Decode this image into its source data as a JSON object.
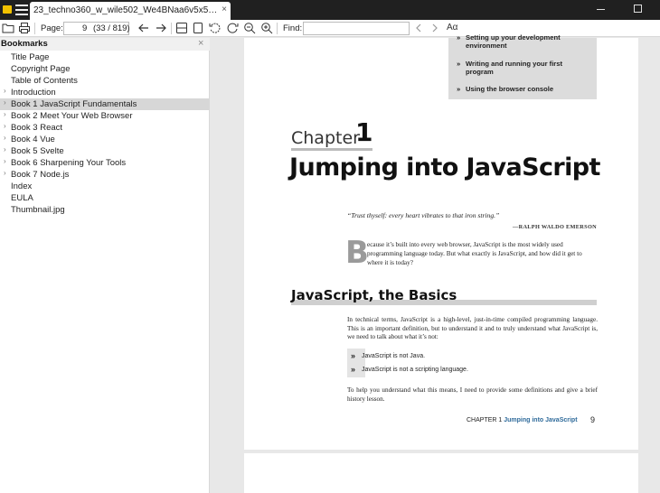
{
  "window": {
    "tab_title": "23_techno360_w_wile502_We4BNaa6v5x5EgPep...",
    "tab_close": "×"
  },
  "toolbar": {
    "page_label": "Page:",
    "page_value": "9",
    "page_info": "(33 / 819)",
    "find_label": "Find:",
    "find_value": "",
    "aa_label": "Aα"
  },
  "sidebar": {
    "title": "Bookmarks",
    "close": "×",
    "items": [
      {
        "label": "Title Page",
        "expandable": false,
        "selected": false
      },
      {
        "label": "Copyright Page",
        "expandable": false,
        "selected": false
      },
      {
        "label": "Table of Contents",
        "expandable": false,
        "selected": false
      },
      {
        "label": "Introduction",
        "expandable": true,
        "selected": false
      },
      {
        "label": "Book 1 JavaScript Fundamentals",
        "expandable": true,
        "selected": true
      },
      {
        "label": "Book 2 Meet Your Web Browser",
        "expandable": true,
        "selected": false
      },
      {
        "label": "Book 3 React",
        "expandable": true,
        "selected": false
      },
      {
        "label": "Book 4 Vue",
        "expandable": true,
        "selected": false
      },
      {
        "label": "Book 5 Svelte",
        "expandable": true,
        "selected": false
      },
      {
        "label": "Book 6 Sharpening Your Tools",
        "expandable": true,
        "selected": false
      },
      {
        "label": "Book 7 Node.js",
        "expandable": true,
        "selected": false
      },
      {
        "label": "Index",
        "expandable": false,
        "selected": false
      },
      {
        "label": "EULA",
        "expandable": false,
        "selected": false
      },
      {
        "label": "Thumbnail.jpg",
        "expandable": false,
        "selected": false
      }
    ]
  },
  "document": {
    "toc_items": [
      "Setting up your development environment",
      "Writing and running your first program",
      "Using the browser console"
    ],
    "chapter_word": "Chapter",
    "chapter_number": "1",
    "chapter_title": "Jumping into JavaScript",
    "quote": "“Trust thyself: every heart vibrates to that iron string.”",
    "attribution": "—RALPH WALDO EMERSON",
    "dropcap": "B",
    "para1": "ecause it’s built into every web browser, JavaScript is the most widely used programming language today. But what exactly is JavaScript, and how did it get to where it is today?",
    "section_title": "JavaScript, the Basics",
    "para2": "In technical terms, JavaScript is a high-level, just-in-time compiled programming language. This is an important definition, but to understand it and to truly understand what JavaScript is, we need to talk about what it’s not:",
    "bullets": [
      "JavaScript is not Java.",
      "JavaScript is not a scripting language."
    ],
    "para3": "To help you understand what this means, I need to provide some definitions and give a brief history lesson.",
    "footer_chapter": "CHAPTER 1",
    "footer_title": "Jumping into JavaScript",
    "page_number": "9"
  }
}
